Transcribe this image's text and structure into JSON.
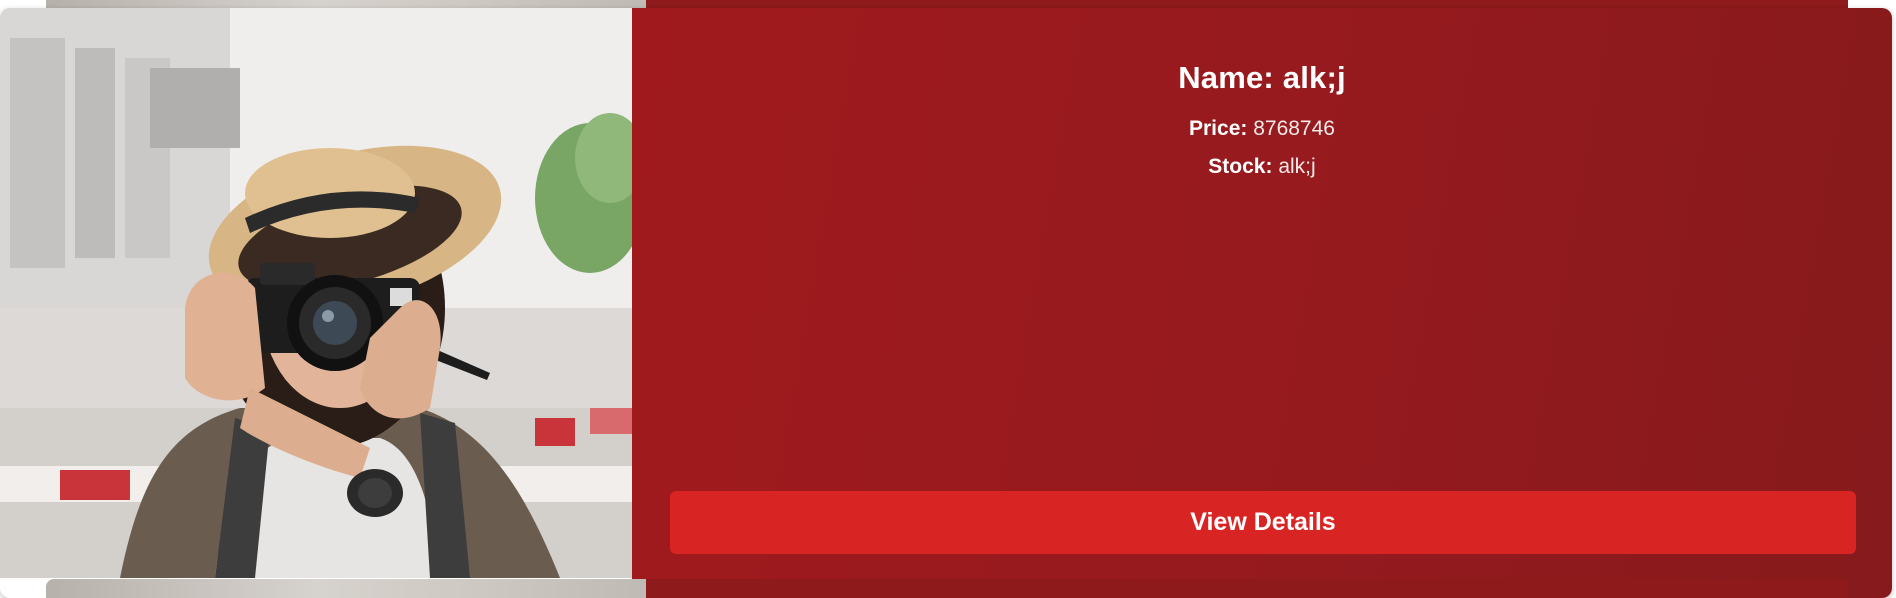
{
  "product": {
    "name_label": "Name:",
    "name_value": "alk;j",
    "price_label": "Price:",
    "price_value": "8768746",
    "stock_label": "Stock:",
    "stock_value": "alk;j",
    "image_icon": "photographer-with-camera-image"
  },
  "actions": {
    "view_details_label": "View Details"
  },
  "colors": {
    "card_background": "#951a1e",
    "button_background": "#d92424",
    "text": "#ffffff"
  }
}
